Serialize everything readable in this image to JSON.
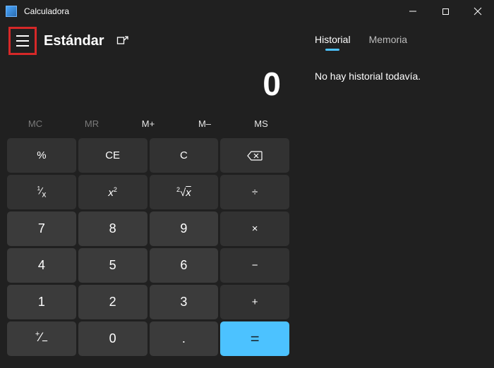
{
  "window": {
    "title": "Calculadora"
  },
  "header": {
    "mode": "Estándar"
  },
  "tabs": {
    "history": "Historial",
    "memory": "Memoria"
  },
  "history": {
    "empty_message": "No hay historial todavía."
  },
  "display": {
    "value": "0"
  },
  "memory_buttons": {
    "mc": "MC",
    "mr": "MR",
    "mplus": "M+",
    "mminus": "M–",
    "ms": "MS"
  },
  "keys": {
    "percent": "%",
    "ce": "CE",
    "c": "C",
    "reciprocal": "1⁄x",
    "square": "x²",
    "sqrt": "²√x",
    "divide": "÷",
    "n7": "7",
    "n8": "8",
    "n9": "9",
    "multiply": "×",
    "n4": "4",
    "n5": "5",
    "n6": "6",
    "minus": "−",
    "n1": "1",
    "n2": "2",
    "n3": "3",
    "plus": "+",
    "negate": "+/-",
    "n0": "0",
    "decimal": ".",
    "equals": "="
  }
}
